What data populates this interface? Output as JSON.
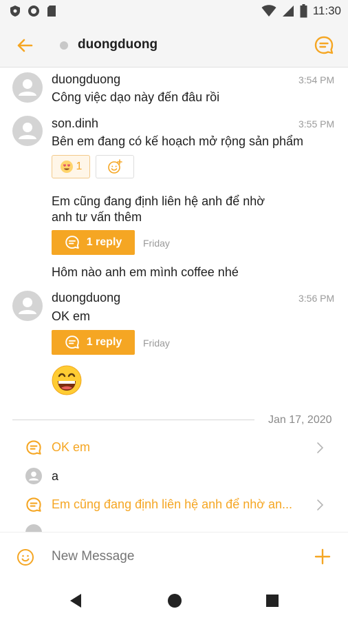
{
  "status_bar": {
    "time": "11:30"
  },
  "app_bar": {
    "title": "duongduong"
  },
  "messages": [
    {
      "name": "duongduong",
      "time": "3:54 PM",
      "text": "Công việc dạo này đến đâu rồi"
    },
    {
      "name": "son.dinh",
      "time": "3:55 PM",
      "text": "Bên em đang có kế hoạch mở rộng sản phẩm",
      "reaction_count": "1"
    },
    {
      "text_line1": "Em cũng đang định liên hệ anh để nhờ",
      "text_line2": "anh tư vấn thêm",
      "reply_label": "1 reply",
      "reply_day": "Friday"
    },
    {
      "text": "Hôm nào anh em mình coffee nhé"
    },
    {
      "name": "duongduong",
      "time": "3:56 PM",
      "text": "OK em",
      "reply_label": "1 reply",
      "reply_day": "Friday"
    }
  ],
  "date_divider": "Jan 17, 2020",
  "thread_list": [
    {
      "text": "OK em",
      "type": "thread"
    },
    {
      "text": "a",
      "type": "user"
    },
    {
      "text": "Em cũng đang định liên hệ anh để nhờ an...",
      "type": "thread"
    }
  ],
  "composer": {
    "placeholder": "New Message"
  },
  "colors": {
    "accent": "#f5a623",
    "avatar": "#d4d4d4",
    "muted": "#9a9a9a"
  }
}
